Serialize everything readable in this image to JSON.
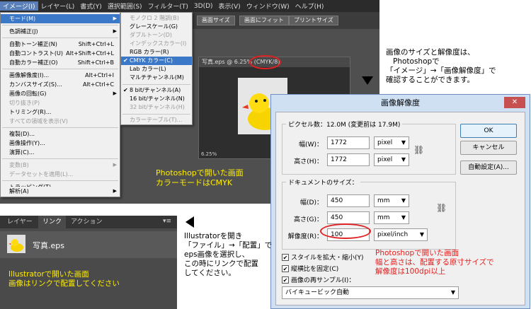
{
  "menubar": [
    "イメージ(I)",
    "レイヤー(L)",
    "書式(Y)",
    "選択範囲(S)",
    "フィルター(T)",
    "3D(D)",
    "表示(V)",
    "ウィンドウ(W)",
    "ヘルプ(H)"
  ],
  "optbar": {
    "btn1": "画面サイズ",
    "btn2": "画面にフィット",
    "btn3": "プリントサイズ"
  },
  "image_menu": [
    {
      "label": "モード(M)",
      "shortcut": "",
      "submenu": true,
      "highlight": true,
      "disabled": false
    },
    {
      "label": "色調補正(J)",
      "shortcut": "",
      "submenu": true,
      "highlight": false,
      "disabled": false
    },
    {
      "label": "自動トーン補正(N)",
      "shortcut": "Shift+Ctrl+L",
      "submenu": false,
      "highlight": false,
      "disabled": false
    },
    {
      "label": "自動コントラスト(U)",
      "shortcut": "Alt+Shift+Ctrl+L",
      "submenu": false,
      "highlight": false,
      "disabled": false
    },
    {
      "label": "自動カラー補正(O)",
      "shortcut": "Shift+Ctrl+B",
      "submenu": false,
      "highlight": false,
      "disabled": false
    },
    {
      "label": "画像解像度(I)...",
      "shortcut": "Alt+Ctrl+I",
      "submenu": false,
      "highlight": false,
      "disabled": false
    },
    {
      "label": "カンバスサイズ(S)...",
      "shortcut": "Alt+Ctrl+C",
      "submenu": false,
      "highlight": false,
      "disabled": false
    },
    {
      "label": "画像の回転(G)",
      "shortcut": "",
      "submenu": true,
      "highlight": false,
      "disabled": false
    },
    {
      "label": "切り抜き(P)",
      "shortcut": "",
      "submenu": false,
      "highlight": false,
      "disabled": true
    },
    {
      "label": "トリミング(R)...",
      "shortcut": "",
      "submenu": false,
      "highlight": false,
      "disabled": false
    },
    {
      "label": "すべての領域を表示(V)",
      "shortcut": "",
      "submenu": false,
      "highlight": false,
      "disabled": true
    },
    {
      "label": "複製(D)...",
      "shortcut": "",
      "submenu": false,
      "highlight": false,
      "disabled": false
    },
    {
      "label": "画像操作(Y)...",
      "shortcut": "",
      "submenu": false,
      "highlight": false,
      "disabled": false
    },
    {
      "label": "演算(C)...",
      "shortcut": "",
      "submenu": false,
      "highlight": false,
      "disabled": false
    },
    {
      "label": "変数(B)",
      "shortcut": "",
      "submenu": true,
      "highlight": false,
      "disabled": true
    },
    {
      "label": "データセットを適用(L)...",
      "shortcut": "",
      "submenu": false,
      "highlight": false,
      "disabled": true
    },
    {
      "label": "トラッピング(T)...",
      "shortcut": "",
      "submenu": false,
      "highlight": false,
      "disabled": false
    },
    {
      "label": "解析(A)",
      "shortcut": "",
      "submenu": true,
      "highlight": false,
      "disabled": false
    }
  ],
  "mode_menu": [
    {
      "label": "モノクロ 2 階調(B)",
      "check": false,
      "highlight": false,
      "disabled": true
    },
    {
      "label": "グレースケール(G)",
      "check": false,
      "highlight": false,
      "disabled": false
    },
    {
      "label": "ダブルトーン(D)",
      "check": false,
      "highlight": false,
      "disabled": true
    },
    {
      "label": "インデックスカラー(I)",
      "check": false,
      "highlight": false,
      "disabled": true
    },
    {
      "label": "RGB カラー(R)",
      "check": false,
      "highlight": false,
      "disabled": false
    },
    {
      "label": "CMYK カラー(C)",
      "check": true,
      "highlight": true,
      "disabled": false
    },
    {
      "label": "Lab カラー(L)",
      "check": false,
      "highlight": false,
      "disabled": false
    },
    {
      "label": "マルチチャンネル(M)",
      "check": false,
      "highlight": false,
      "disabled": false
    },
    {
      "label": "8 bit/チャンネル(A)",
      "check": true,
      "highlight": false,
      "disabled": false
    },
    {
      "label": "16 bit/チャンネル(N)",
      "check": false,
      "highlight": false,
      "disabled": false
    },
    {
      "label": "32 bit/チャンネル(H)",
      "check": false,
      "highlight": false,
      "disabled": true
    },
    {
      "label": "カラーテーブル(T)...",
      "check": false,
      "highlight": false,
      "disabled": true
    }
  ],
  "document": {
    "tab": "写真.eps @ 6.25% (CMYK/8)",
    "zoom": "6.25%"
  },
  "notes": {
    "ps_line1": "Photoshopで開いた画面",
    "ps_line2": "カラーモードはCMYK",
    "tr_line1": "画像のサイズと解像度は、",
    "tr_line2": "Photoshopで",
    "tr_line3": "「イメージ」→「画像解像度」で",
    "tr_line4": "確認することができます。",
    "red_line1": "Photoshopで開いた画面",
    "red_line2": "幅と高さは、配置する原寸サイズで",
    "red_line3": "解像度は100dpi以上",
    "ai_line1": "Illustratorで開いた画面",
    "ai_line2": "画像はリンクで配置してください",
    "ill_line1": "Illustratorを開き",
    "ill_line2": "「ファイル」→「配置」で",
    "ill_line3": "eps画像を選択し、",
    "ill_line4": "この時にリンクで配置",
    "ill_line5": "してください。"
  },
  "dialog": {
    "title": "画像解像度",
    "close": "✕",
    "pixel_group": "ピクセル数：12.0M (変更前は 17.9M)",
    "width_label": "幅(W)：",
    "width_value": "1772",
    "width_unit": "pixel",
    "height_label": "高さ(H)：",
    "height_value": "1772",
    "height_unit": "pixel",
    "doc_group": "ドキュメントのサイズ：",
    "dwidth_label": "幅(D)：",
    "dwidth_value": "450",
    "dwidth_unit": "mm",
    "dheight_label": "高さ(G)：",
    "dheight_value": "450",
    "dheight_unit": "mm",
    "res_label": "解像度(R)：",
    "res_value": "100",
    "res_unit": "pixel/inch",
    "ok": "OK",
    "cancel": "キャンセル",
    "auto": "自動設定(A)...",
    "cb1": "スタイルを拡大・縮小(Y)",
    "cb2": "縦横比を固定(C)",
    "cb3": "画像の再サンプル(I)：",
    "resample": "バイキュービック自動"
  },
  "ai": {
    "tab1": "レイヤー",
    "tab2": "リンク",
    "tab3": "アクション",
    "menu": "▾≡",
    "file": "写真.eps"
  }
}
